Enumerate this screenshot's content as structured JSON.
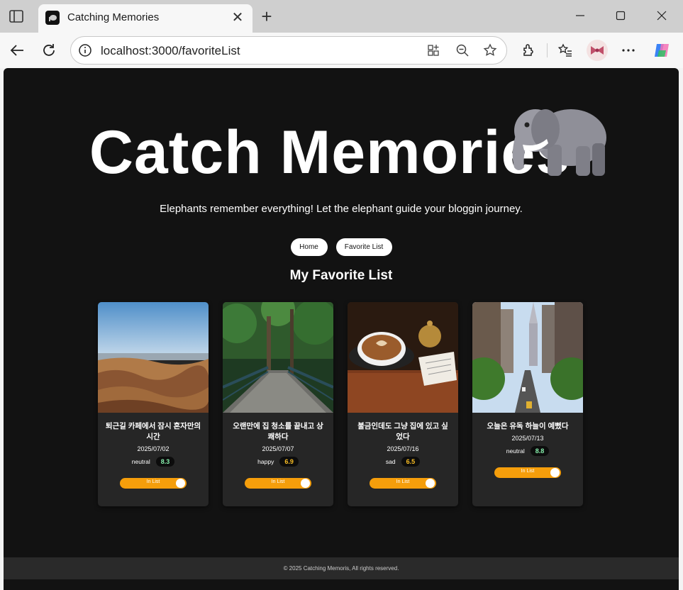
{
  "browser": {
    "tab_title": "Catching Memories",
    "url": "localhost:3000/favoriteList"
  },
  "hero": {
    "title": "Catch Memories",
    "subtitle": "Elephants remember everything! Let the elephant guide your bloggin journey."
  },
  "nav": {
    "home_label": "Home",
    "favorite_label": "Favorite List"
  },
  "section": {
    "title": "My Favorite List"
  },
  "cards": [
    {
      "title": "퇴근길 카페에서 잠시 혼자만의 시간",
      "date": "2025/07/02",
      "mood": "neutral",
      "score": "8.3",
      "score_color": "#86efac",
      "toggle_label": "In List"
    },
    {
      "title": "오랜만에 집 청소를 끝내고 상쾌하다",
      "date": "2025/07/07",
      "mood": "happy",
      "score": "6.9",
      "score_color": "#fbbf24",
      "toggle_label": "In List"
    },
    {
      "title": "불금인데도 그냥 집에 있고 싶었다",
      "date": "2025/07/16",
      "mood": "sad",
      "score": "6.5",
      "score_color": "#fbbf24",
      "toggle_label": "In List"
    },
    {
      "title": "오늘은 유독 하늘이 예뻤다",
      "date": "2025/07/13",
      "mood": "neutral",
      "score": "8.8",
      "score_color": "#86efac",
      "toggle_label": "In List"
    }
  ],
  "footer": {
    "text": "© 2025 Catching Memoris, All rights reserved."
  },
  "colors": {
    "accent": "#f59e0b",
    "page_bg": "#121212",
    "card_bg": "#262626"
  }
}
